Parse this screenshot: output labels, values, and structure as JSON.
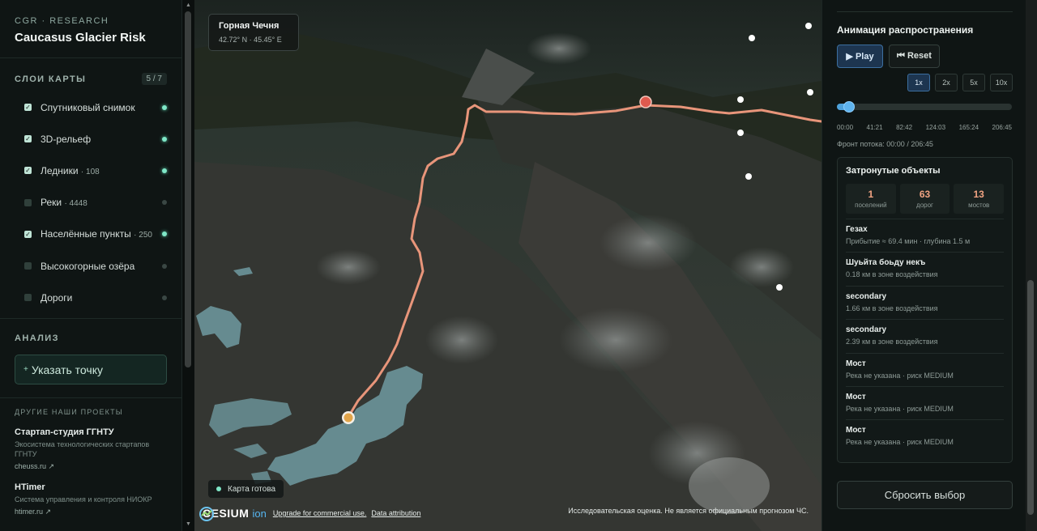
{
  "brand": {
    "kicker": "CGR · RESEARCH",
    "title": "Caucasus Glacier Risk"
  },
  "layers": {
    "title": "СЛОИ КАРТЫ",
    "badge": "5 / 7",
    "items": [
      {
        "label": "Спутниковый снимок",
        "count": "",
        "checked": true
      },
      {
        "label": "3D-рельеф",
        "count": "",
        "checked": true
      },
      {
        "label": "Ледники",
        "count": "· 108",
        "checked": true
      },
      {
        "label": "Реки",
        "count": "· 4448",
        "checked": false
      },
      {
        "label": "Населённые пункты",
        "count": "· 250",
        "checked": true
      },
      {
        "label": "Высокогорные озёра",
        "count": "",
        "checked": false
      },
      {
        "label": "Дороги",
        "count": "",
        "checked": false
      }
    ]
  },
  "analysis": {
    "title": "АНАЛИЗ",
    "button": "Указать точку",
    "button_icon": "+"
  },
  "other": {
    "title": "ДРУГИЕ НАШИ ПРОЕКТЫ",
    "projects": [
      {
        "title": "Стартап-студия ГГНТУ",
        "desc": "Экосистема технологических стартапов ГГНТУ",
        "link": "cheuss.ru ↗"
      },
      {
        "title": "HTimer",
        "desc": "Система управления и контроля НИОКР",
        "link": "htimer.ru ↗"
      }
    ]
  },
  "map": {
    "location_title": "Горная Чечня",
    "location_coords": "42.72° N · 45.45° E",
    "status": "Карта готова",
    "cesium_logo": "CESIUM",
    "cesium_ion": "ion",
    "upgrade_link": "Upgrade for commercial use.",
    "attribution_link": "Data attribution",
    "disclaimer": "Исследовательская оценка. Не является официальным прогнозом ЧС.",
    "colors": {
      "flow": "#e8957a",
      "glacier": "#8fd1de",
      "village": "#ffffff",
      "source": "#e05a4e"
    }
  },
  "animation": {
    "title": "Анимация распространения",
    "play": "▶ Play",
    "reset": "⏮ Reset",
    "speeds": [
      "1x",
      "2x",
      "5x",
      "10x"
    ],
    "active_speed": "1x",
    "progress": 0.07,
    "ticks": [
      "00:00",
      "41:21",
      "82:42",
      "124:03",
      "165:24",
      "206:45"
    ],
    "front": "Фронт потока: 00:00 / 206:45"
  },
  "affected": {
    "title": "Затронутые объекты",
    "stats": [
      {
        "num": "1",
        "label": "поселений"
      },
      {
        "num": "63",
        "label": "дорог"
      },
      {
        "num": "13",
        "label": "мостов"
      }
    ],
    "items": [
      {
        "name": "Гезах",
        "detail": "Прибытие ≈ 69.4 мин · глубина 1.5 м"
      },
      {
        "name": "Шуьйта боьду некъ",
        "detail": "0.18 км в зоне воздействия"
      },
      {
        "name": "secondary",
        "detail": "1.66 км в зоне воздействия"
      },
      {
        "name": "secondary",
        "detail": "2.39 км в зоне воздействия"
      },
      {
        "name": "Мост",
        "detail": "Река не указана · риск MEDIUM"
      },
      {
        "name": "Мост",
        "detail": "Река не указана · риск MEDIUM"
      },
      {
        "name": "Мост",
        "detail": "Река не указана · риск MEDIUM"
      }
    ]
  },
  "reset_selection": "Сбросить выбор"
}
